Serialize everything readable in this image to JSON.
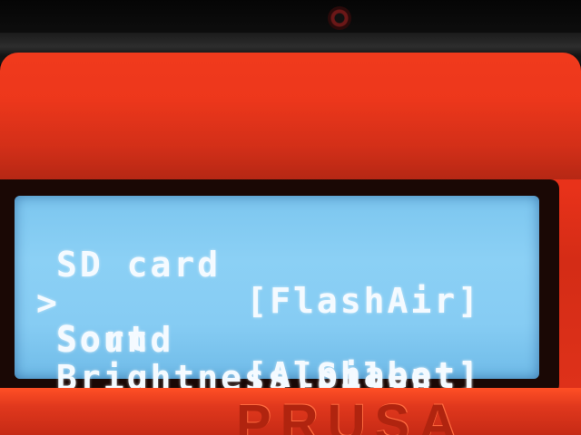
{
  "lcd_menu": {
    "cursor": ">",
    "submenu_arrow": "→",
    "items": [
      {
        "label": "SD card",
        "value": "[FlashAir]"
      },
      {
        "label": "Sort",
        "value": "[Alphabet]"
      },
      {
        "label": "Sound",
        "value": "[Silent]"
      },
      {
        "label": "Brightness",
        "value": ""
      }
    ]
  },
  "printer_branding": {
    "text": "PRUSA"
  },
  "colors": {
    "lcd_background": "#86ccf3",
    "lcd_text": "#f4faff",
    "housing": "#e8321a"
  }
}
